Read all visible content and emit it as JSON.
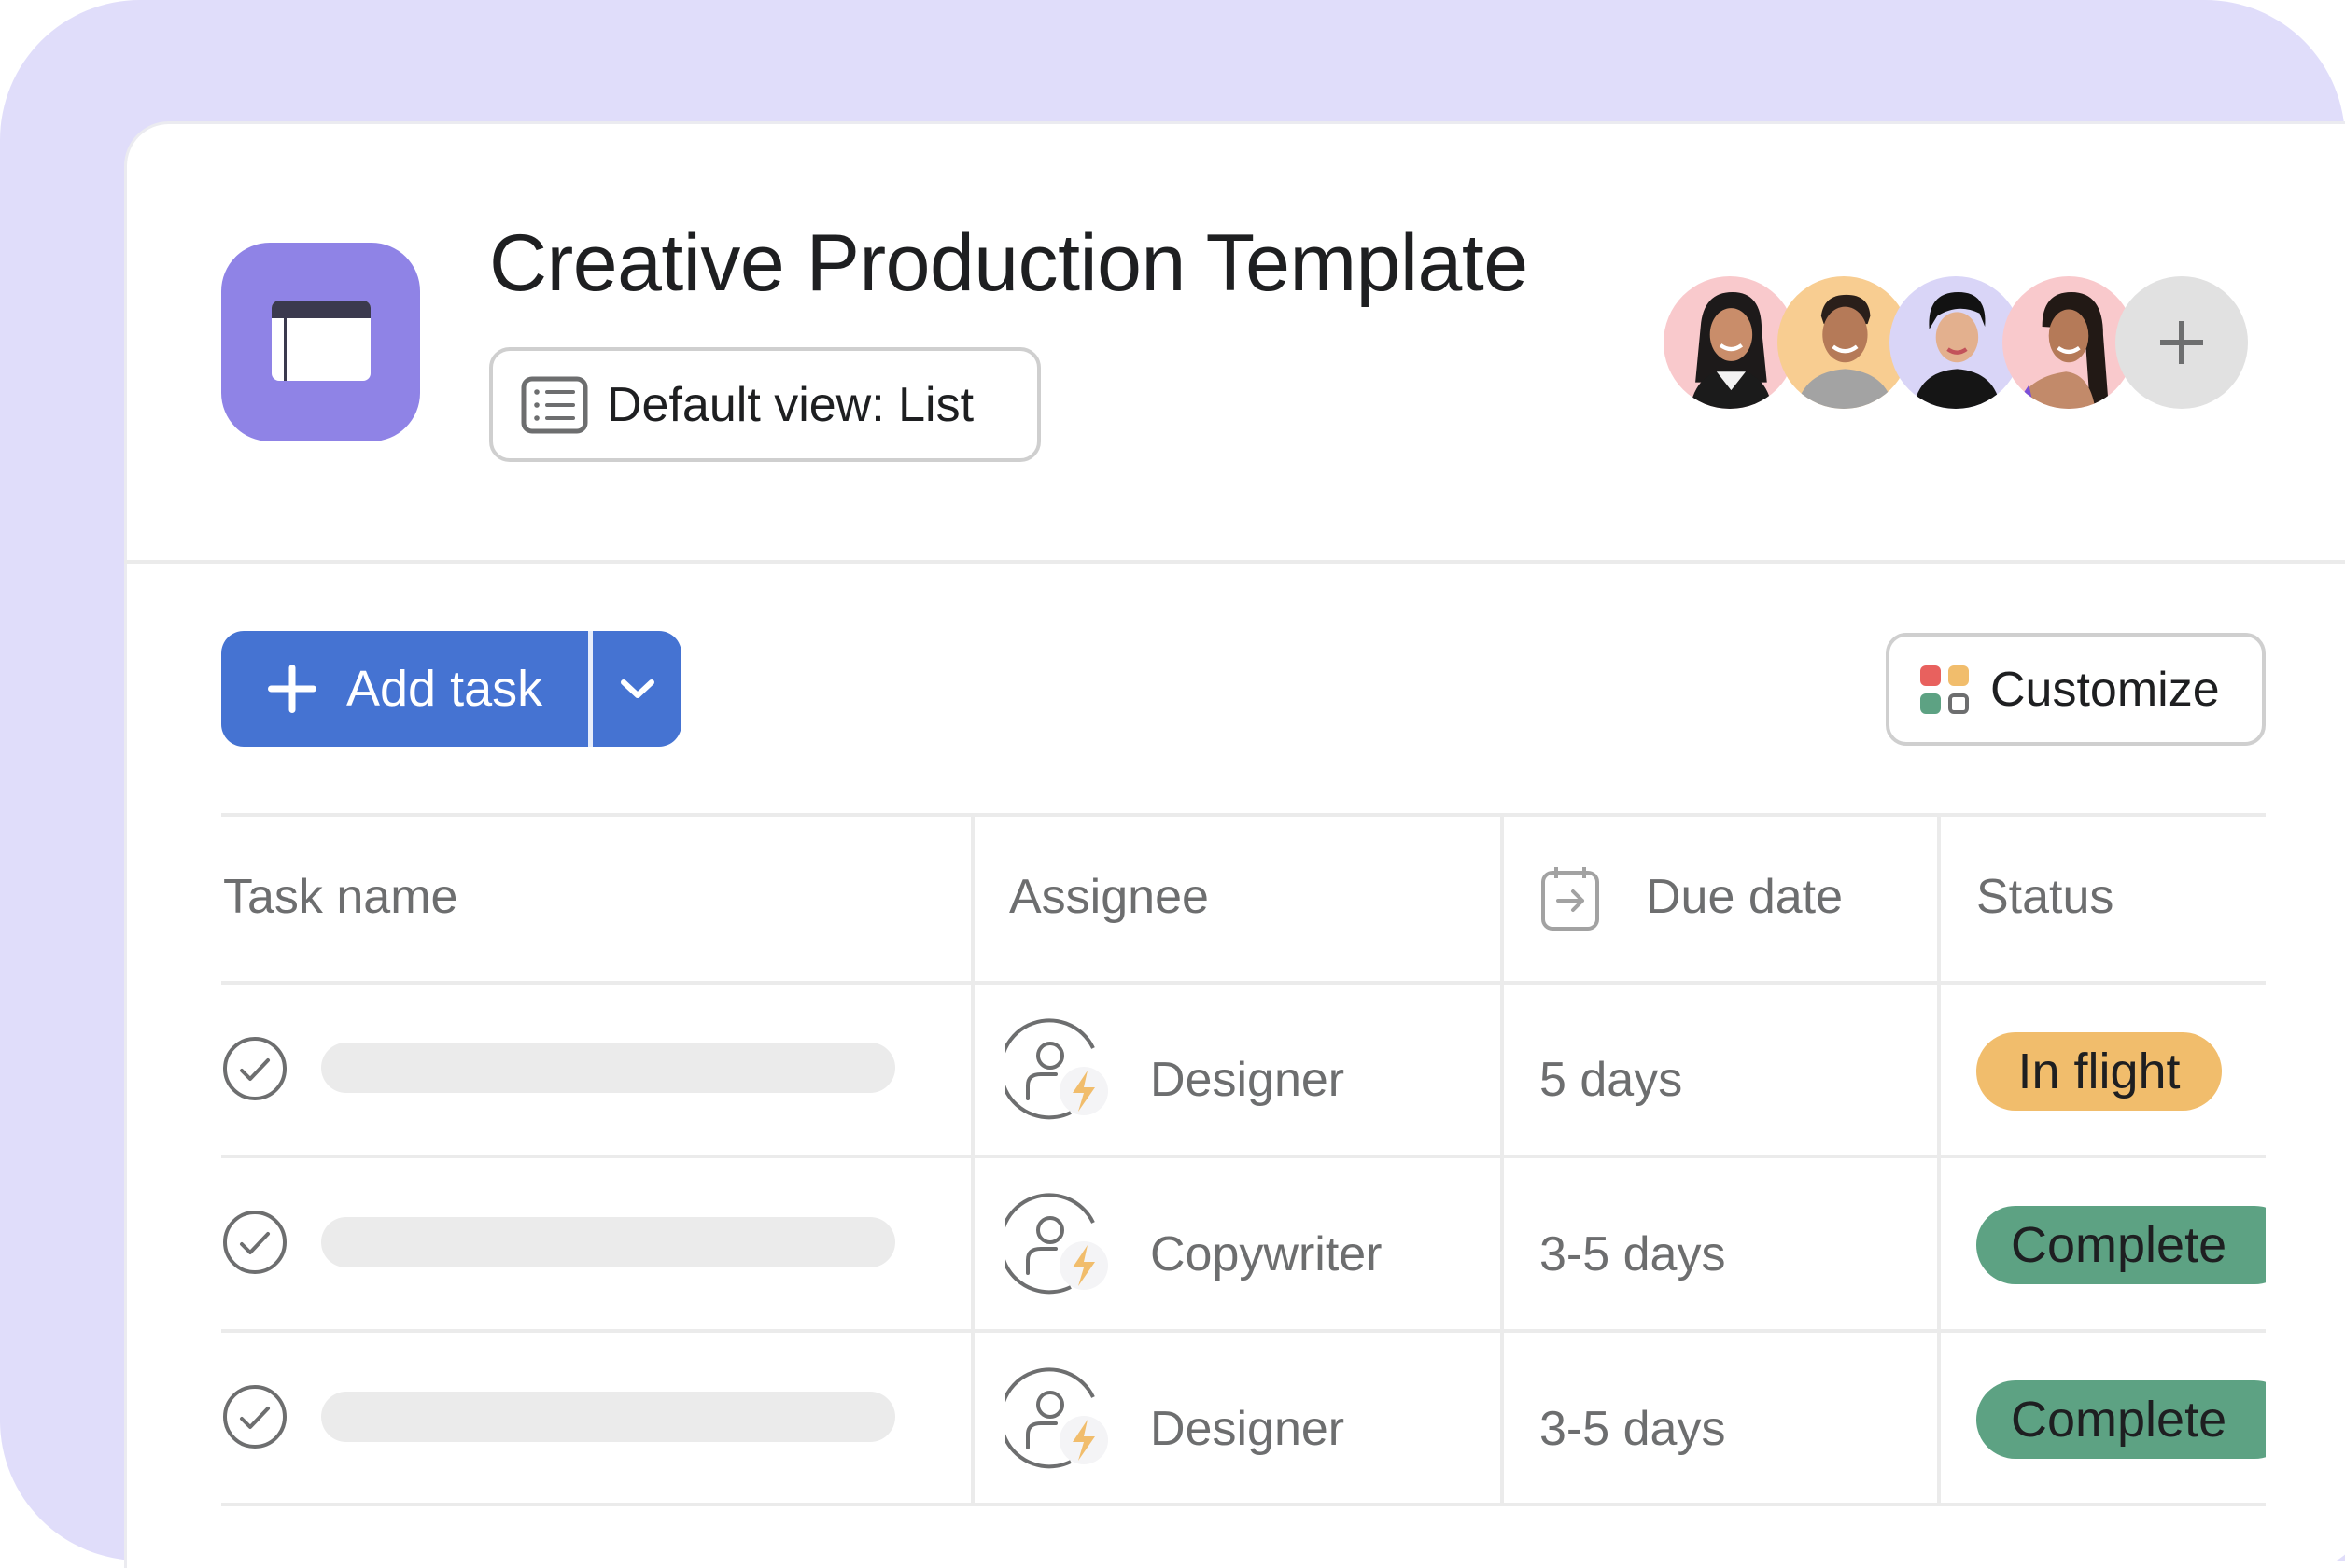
{
  "project": {
    "title": "Creative Production Template",
    "icon": "project-board-icon",
    "default_view_label": "Default view: List",
    "default_view_icon": "list-icon"
  },
  "members": {
    "avatars": [
      {
        "name": "member-1",
        "bg": "#f9c9cc"
      },
      {
        "name": "member-2",
        "bg": "#f8cd91"
      },
      {
        "name": "member-3",
        "bg": "#d9d5f7"
      },
      {
        "name": "member-4",
        "bg": "#f9c9cc"
      }
    ],
    "add_icon": "plus-icon"
  },
  "toolbar": {
    "add_task_label": "Add task",
    "add_task_icon": "plus-icon",
    "dropdown_icon": "chevron-down-icon",
    "customize_label": "Customize",
    "customize_icon": "customize-grid-icon"
  },
  "table": {
    "columns": [
      {
        "label": "Task name"
      },
      {
        "label": "Assignee"
      },
      {
        "label": "Due date",
        "icon": "calendar-arrow-icon"
      },
      {
        "label": "Status"
      }
    ],
    "rows": [
      {
        "task_name": "",
        "assignee": "Designer",
        "due": "5 days",
        "status": "In flight",
        "status_color": "#f1bd6c"
      },
      {
        "task_name": "",
        "assignee": "Copywriter",
        "due": "3-5 days",
        "status": "Complete",
        "status_color": "#5da283"
      },
      {
        "task_name": "",
        "assignee": "Designer",
        "due": "3-5 days",
        "status": "Complete",
        "status_color": "#5da283"
      }
    ]
  },
  "colors": {
    "accent": "#4573d2",
    "background": "#e0ddfa",
    "app_icon": "#8f83e6",
    "in_flight": "#f1bd6c",
    "complete": "#5da283",
    "bolt": "#f1bd6c"
  }
}
